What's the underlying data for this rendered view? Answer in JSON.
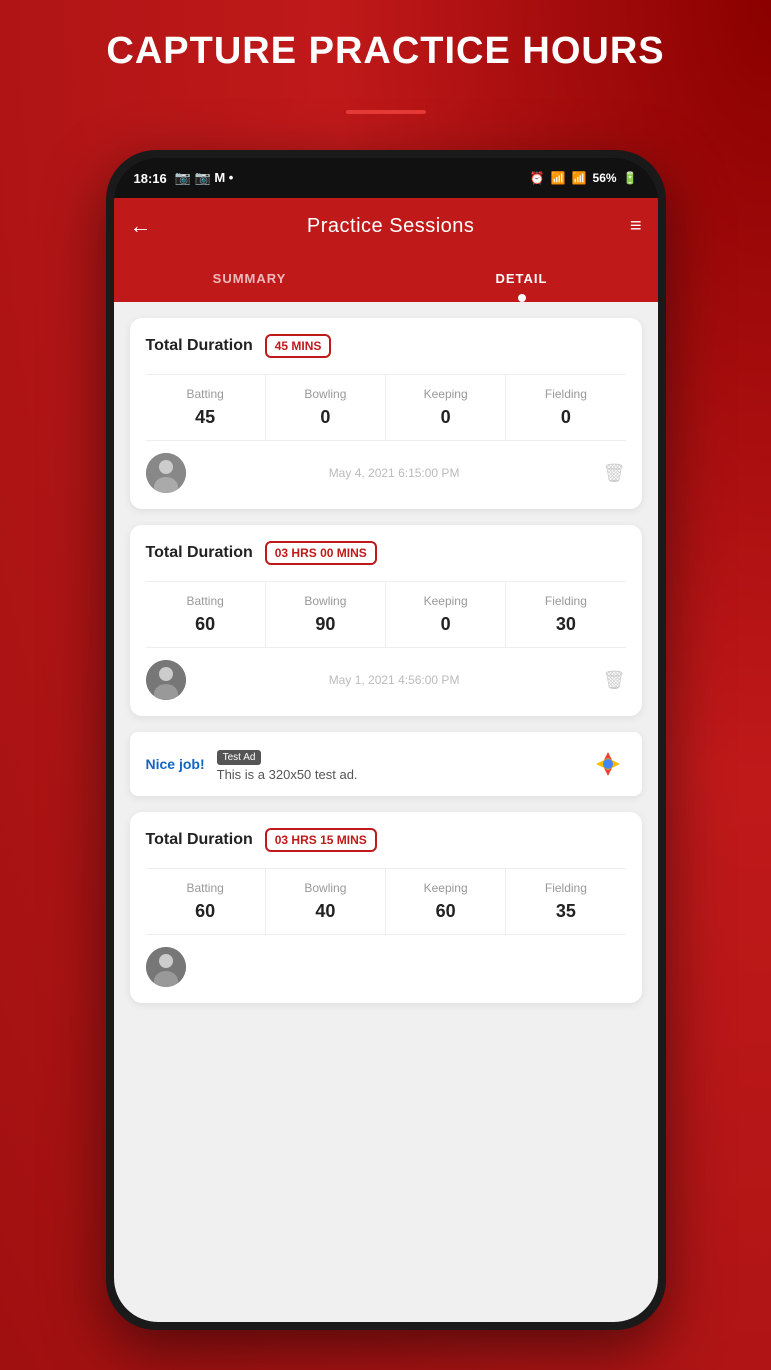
{
  "page": {
    "header_title": "CAPTURE PRACTICE HOURS"
  },
  "status_bar": {
    "time": "18:16",
    "battery": "56%"
  },
  "app_bar": {
    "title": "Practice Sessions",
    "back_label": "←",
    "filter_label": "≡"
  },
  "tabs": [
    {
      "id": "summary",
      "label": "SUMMARY",
      "active": false
    },
    {
      "id": "detail",
      "label": "DETAIL",
      "active": true
    }
  ],
  "sessions": [
    {
      "id": 1,
      "total_duration_label": "Total Duration",
      "badge": "45 MINS",
      "stats": [
        {
          "label": "Batting",
          "value": "45"
        },
        {
          "label": "Bowling",
          "value": "0"
        },
        {
          "label": "Keeping",
          "value": "0"
        },
        {
          "label": "Fielding",
          "value": "0"
        }
      ],
      "date": "May 4, 2021 6:15:00 PM"
    },
    {
      "id": 2,
      "total_duration_label": "Total Duration",
      "badge": "03 HRS 00 MINS",
      "stats": [
        {
          "label": "Batting",
          "value": "60"
        },
        {
          "label": "Bowling",
          "value": "90"
        },
        {
          "label": "Keeping",
          "value": "0"
        },
        {
          "label": "Fielding",
          "value": "30"
        }
      ],
      "date": "May 1, 2021 4:56:00 PM"
    },
    {
      "id": 3,
      "total_duration_label": "Total Duration",
      "badge": "03 HRS 15 MINS",
      "stats": [
        {
          "label": "Batting",
          "value": "60"
        },
        {
          "label": "Bowling",
          "value": "40"
        },
        {
          "label": "Keeping",
          "value": "60"
        },
        {
          "label": "Fielding",
          "value": "35"
        }
      ],
      "date": ""
    }
  ],
  "ad": {
    "nice_job": "Nice job!",
    "label": "Test Ad",
    "description": "This is a 320x50 test ad."
  },
  "colors": {
    "primary": "#c0191a",
    "text_dark": "#222222",
    "text_muted": "#999999"
  }
}
